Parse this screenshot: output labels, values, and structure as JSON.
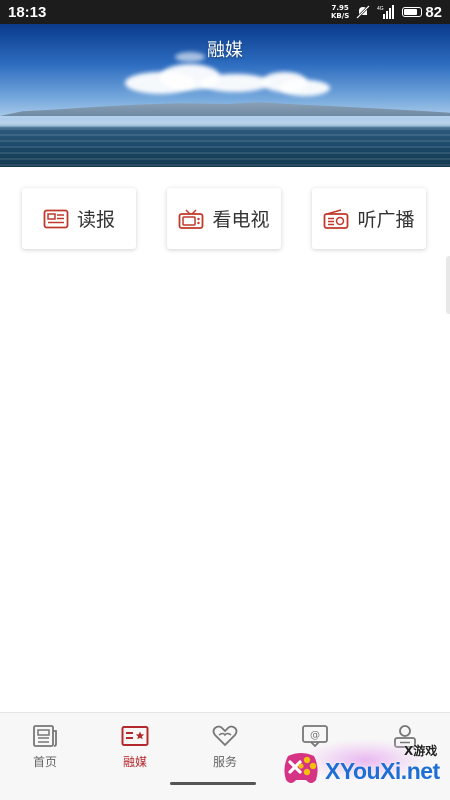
{
  "status_bar": {
    "time": "18:13",
    "net_speed_value": "7.95",
    "net_speed_unit": "KB/S",
    "battery_level": "82"
  },
  "header": {
    "title": "融媒"
  },
  "media_cards": [
    {
      "label": "读报",
      "icon": "newspaper-icon"
    },
    {
      "label": "看电视",
      "icon": "tv-icon"
    },
    {
      "label": "听广播",
      "icon": "radio-icon"
    }
  ],
  "tab_bar": {
    "tabs": [
      {
        "label": "首页",
        "icon": "news-icon",
        "active": false
      },
      {
        "label": "融媒",
        "icon": "media-icon",
        "active": true
      },
      {
        "label": "服务",
        "icon": "heart-hands-icon",
        "active": false
      },
      {
        "label": "",
        "icon": "message-icon",
        "active": false
      },
      {
        "label": "",
        "icon": "profile-icon",
        "active": false
      }
    ]
  },
  "watermark": {
    "brand": "XYouXi.net",
    "small_text": "X游戏"
  },
  "colors": {
    "accent": "#b5282b",
    "card_icon": "#c0392b",
    "tab_inactive": "#666666"
  }
}
